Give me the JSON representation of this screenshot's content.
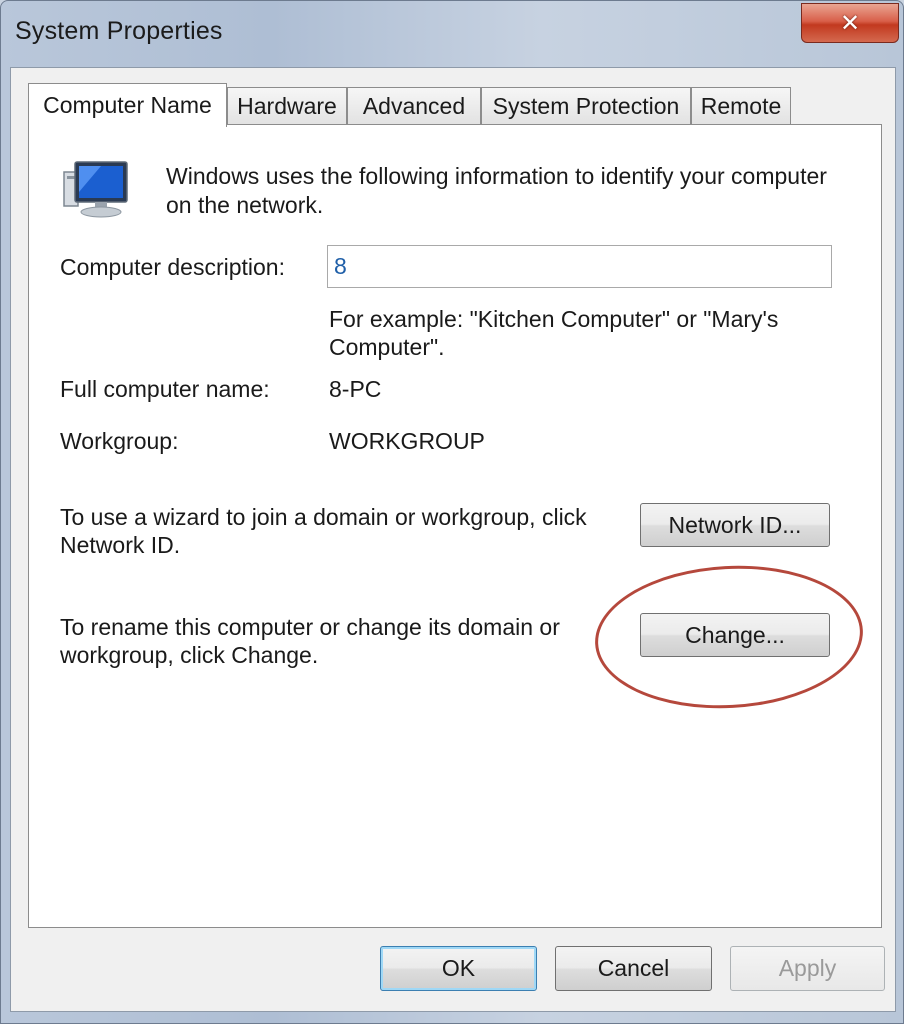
{
  "window": {
    "title": "System Properties",
    "close_icon": "close-icon",
    "close_glyph": "✕"
  },
  "tabs": [
    {
      "label": "Computer Name",
      "active": true
    },
    {
      "label": "Hardware",
      "active": false
    },
    {
      "label": "Advanced",
      "active": false
    },
    {
      "label": "System Protection",
      "active": false
    },
    {
      "label": "Remote",
      "active": false
    }
  ],
  "panel": {
    "icon": "computer-icon",
    "intro_line1": "Windows uses the following information to identify your computer",
    "intro_line2": "on the network.",
    "description_label": "Computer description:",
    "description_value": "8",
    "example_line1": "For example: \"Kitchen Computer\" or \"Mary's",
    "example_line2": "Computer\".",
    "full_name_label": "Full computer name:",
    "full_name_value": "8-PC",
    "workgroup_label": "Workgroup:",
    "workgroup_value": "WORKGROUP",
    "network_text_line1": "To use a wizard to join a domain or workgroup, click",
    "network_text_line2": "Network ID.",
    "network_id_button": "Network ID...",
    "rename_text_line1": "To rename this computer or change its domain or",
    "rename_text_line2": "workgroup, click Change.",
    "change_button": "Change..."
  },
  "footer": {
    "ok": "OK",
    "cancel": "Cancel",
    "apply": "Apply"
  },
  "colors": {
    "highlight_circle": "#b5483c",
    "input_text": "#1f5fa8",
    "close_button": "#c2391f"
  }
}
